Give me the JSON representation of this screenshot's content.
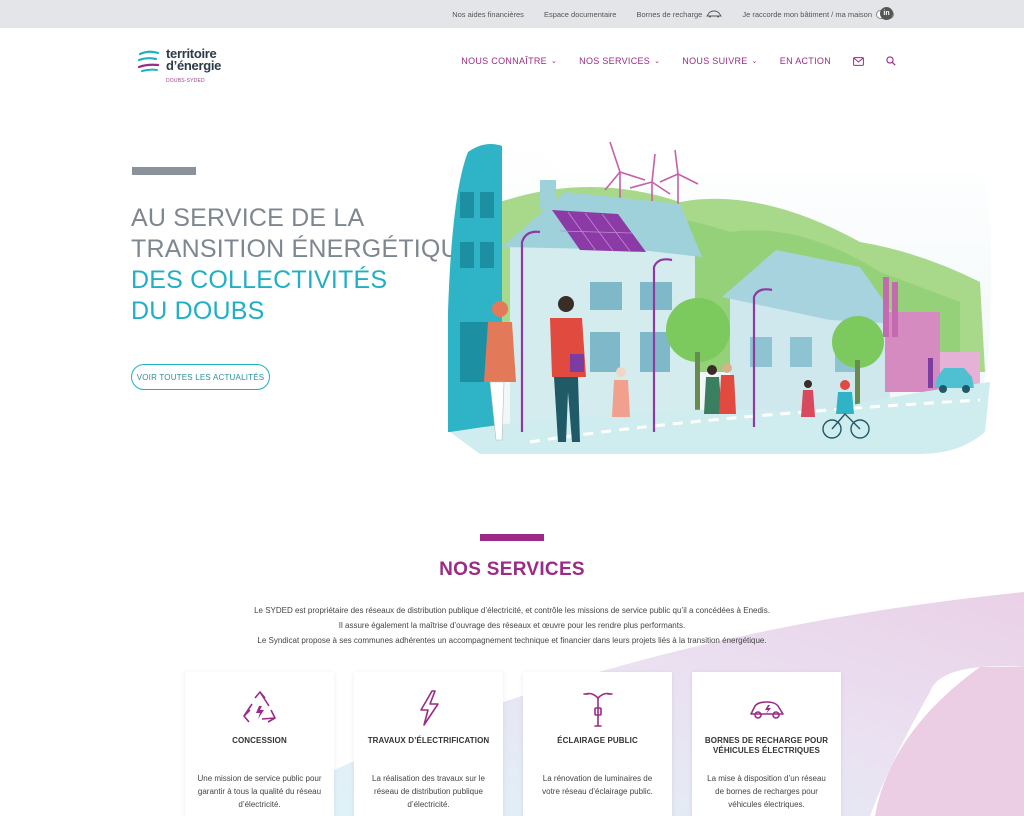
{
  "topbar": {
    "links": [
      {
        "label": "Nos aides financières"
      },
      {
        "label": "Espace documentaire"
      },
      {
        "label": "Bornes de recharge"
      },
      {
        "label": "Je raccorde mon bâtiment / ma maison"
      }
    ],
    "social": "in"
  },
  "logo": {
    "line1": "territoire",
    "line2": "d’énergie",
    "sub": "DOUBS-SYDED"
  },
  "nav": {
    "items": [
      {
        "label": "NOUS CONNAÎTRE"
      },
      {
        "label": "NOS SERVICES"
      },
      {
        "label": "NOUS SUIVRE"
      },
      {
        "label": "EN ACTION"
      }
    ]
  },
  "hero": {
    "title_gray_1": "AU SERVICE DE LA",
    "title_gray_2": "TRANSITION ÉNERGÉTIQUE",
    "title_teal_1": "DES COLLECTIVITÉS",
    "title_teal_2": "DU DOUBS",
    "cta": "VOIR TOUTES LES ACTUALITÉS"
  },
  "services": {
    "title": "NOS SERVICES",
    "intro": [
      "Le SYDED est propriétaire des réseaux de distribution publique d’électricité, et contrôle les missions de service public qu’il a concédées à Enedis.",
      "Il assure également la maîtrise d’ouvrage des réseaux et œuvre pour les rendre plus performants.",
      "Le Syndicat propose à ses communes adhérentes un accompagnement technique et financier dans leurs projets liés à la transition énergétique."
    ],
    "cards": [
      {
        "title": "CONCESSION",
        "desc": "Une mission de service public pour garantir à tous la qualité du réseau d’électricité."
      },
      {
        "title": "TRAVAUX D’ÉLECTRIFICATION",
        "desc": "La réalisation des travaux sur le réseau de distribution publique d’électricité."
      },
      {
        "title": "ÉCLAIRAGE PUBLIC",
        "desc": "La rénovation de luminaires de votre réseau d’éclairage public."
      },
      {
        "title": "BORNES DE RECHARGE POUR VÉHICULES ÉLECTRIQUES",
        "desc": "La mise à disposition d’un réseau de bornes de recharges pour véhicules électriques."
      }
    ]
  },
  "colors": {
    "brand_purple": "#9b2b86",
    "brand_teal": "#1fb0c5",
    "title_gray": "#7e8790",
    "topbar_bg": "#e3e5e8"
  }
}
